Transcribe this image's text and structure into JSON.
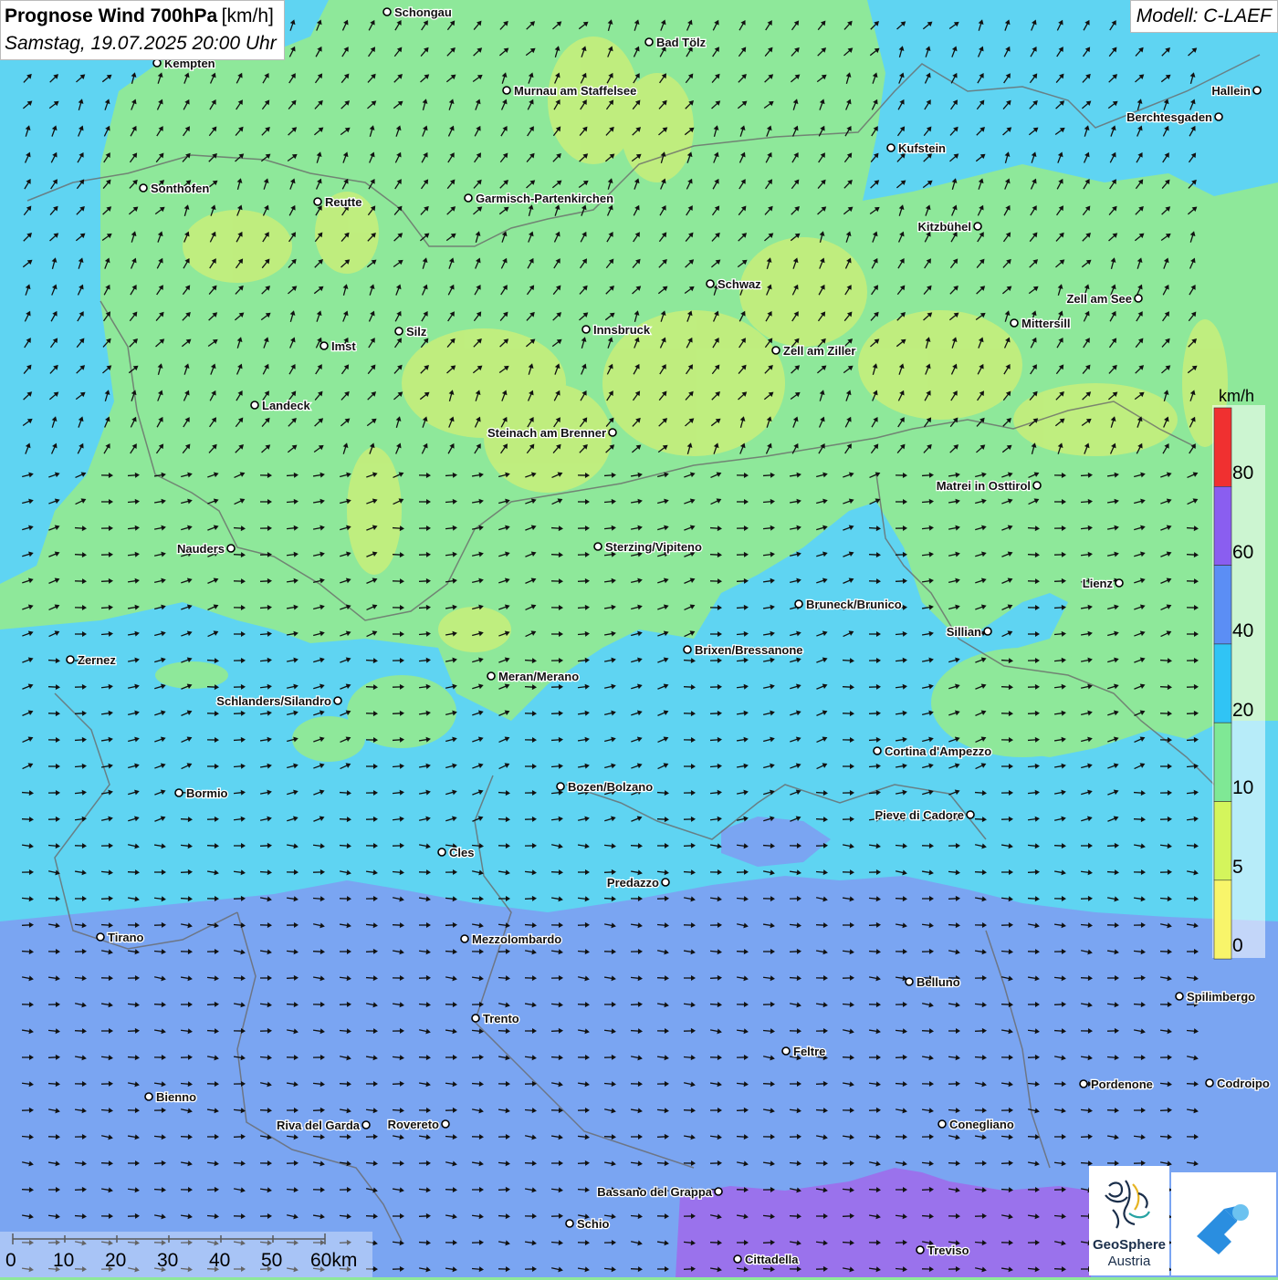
{
  "header": {
    "title": "Prognose Wind 700hPa",
    "unit": "[km/h]",
    "datetime": "Samstag, 19.07.2025 20:00 Uhr"
  },
  "model": "Modell: C-LAEF",
  "legend": {
    "unit": "km/h",
    "ticks": [
      "80",
      "60",
      "40",
      "20",
      "10",
      "5",
      "0"
    ],
    "colors": [
      "#f03030",
      "#8a5ef0",
      "#5b8ef5",
      "#30c4f5",
      "#7fe895",
      "#d4f55c",
      "#f8f56a"
    ]
  },
  "scale": {
    "labels": [
      "0",
      "10",
      "20",
      "30",
      "40",
      "50",
      "60km"
    ]
  },
  "logo": {
    "line1": "GeoSphere",
    "line2": "Austria"
  },
  "cities": [
    {
      "name": "Schongau"
    },
    {
      "name": "Bad Tölz"
    },
    {
      "name": "Kempten"
    },
    {
      "name": "Murnau am Staffelsee"
    },
    {
      "name": "Hallein"
    },
    {
      "name": "Berchtesgaden"
    },
    {
      "name": "Kufstein"
    },
    {
      "name": "Sonthofen"
    },
    {
      "name": "Reutte"
    },
    {
      "name": "Garmisch-Partenkirchen"
    },
    {
      "name": "Kitzbühel"
    },
    {
      "name": "Schwaz"
    },
    {
      "name": "Zell am See"
    },
    {
      "name": "Mittersill"
    },
    {
      "name": "Silz"
    },
    {
      "name": "Innsbruck"
    },
    {
      "name": "Imst"
    },
    {
      "name": "Zell am Ziller"
    },
    {
      "name": "Landeck"
    },
    {
      "name": "Steinach am Brenner"
    },
    {
      "name": "Matrei in Osttirol"
    },
    {
      "name": "Nauders"
    },
    {
      "name": "Sterzing/Vipiteno"
    },
    {
      "name": "Lienz"
    },
    {
      "name": "Bruneck/Brunico"
    },
    {
      "name": "Sillian"
    },
    {
      "name": "Zernez"
    },
    {
      "name": "Brixen/Bressanone"
    },
    {
      "name": "Meran/Merano"
    },
    {
      "name": "Schlanders/Silandro"
    },
    {
      "name": "Cortina d'Ampezzo"
    },
    {
      "name": "Bozen/Bolzano"
    },
    {
      "name": "Bormio"
    },
    {
      "name": "Pieve di Cadore"
    },
    {
      "name": "Cles"
    },
    {
      "name": "Predazzo"
    },
    {
      "name": "Tirano"
    },
    {
      "name": "Mezzolombardo"
    },
    {
      "name": "Belluno"
    },
    {
      "name": "Spilimbergo"
    },
    {
      "name": "Trento"
    },
    {
      "name": "Feltre"
    },
    {
      "name": "Pordenone"
    },
    {
      "name": "Codroipo"
    },
    {
      "name": "Bienno"
    },
    {
      "name": "Riva del Garda"
    },
    {
      "name": "Rovereto"
    },
    {
      "name": "Conegliano"
    },
    {
      "name": "Bassano del Grappa"
    },
    {
      "name": "Schio"
    },
    {
      "name": "Treviso"
    },
    {
      "name": "Cittadella"
    }
  ]
}
